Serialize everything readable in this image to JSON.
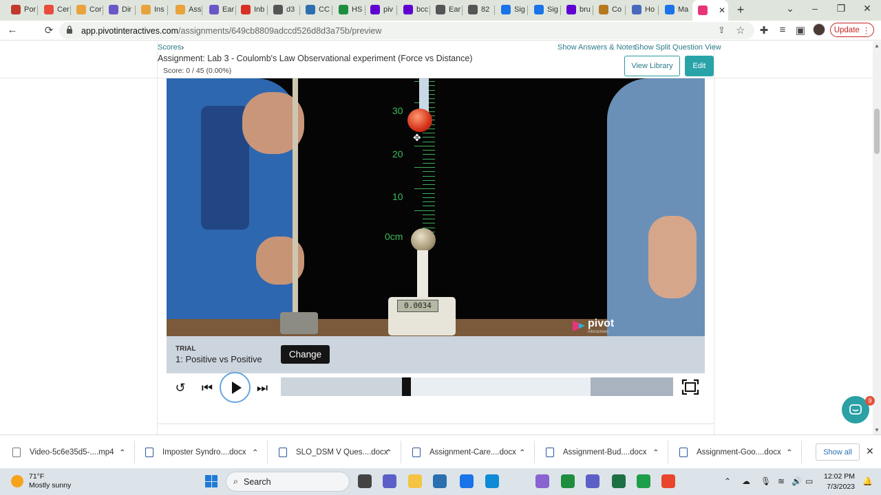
{
  "browser": {
    "tabs": [
      {
        "label": "Por",
        "color": "#c0392b"
      },
      {
        "label": "Cer",
        "color": "#e84c3d"
      },
      {
        "label": "Cor",
        "color": "#e8a33d"
      },
      {
        "label": "Dir",
        "color": "#6a55c9"
      },
      {
        "label": "Ins",
        "color": "#e8a33d"
      },
      {
        "label": "Ass",
        "color": "#e8a33d"
      },
      {
        "label": "Ear",
        "color": "#6a55c9"
      },
      {
        "label": "Inb",
        "color": "#d93025"
      },
      {
        "label": "d3",
        "color": "#555555"
      },
      {
        "label": "CC",
        "color": "#2b6fb0"
      },
      {
        "label": "HS",
        "color": "#1e8e3e"
      },
      {
        "label": "piv",
        "color": "#6001d2"
      },
      {
        "label": "bcc",
        "color": "#6001d2"
      },
      {
        "label": "Ear",
        "color": "#555555"
      },
      {
        "label": "82",
        "color": "#555555"
      },
      {
        "label": "Sig",
        "color": "#1a73e8"
      },
      {
        "label": "Sig",
        "color": "#1a73e8"
      },
      {
        "label": "bru",
        "color": "#6001d2"
      },
      {
        "label": "Co",
        "color": "#b7791f"
      },
      {
        "label": "Ho",
        "color": "#4a69bd"
      },
      {
        "label": "Ma",
        "color": "#1a73e8"
      },
      {
        "label": "",
        "color": "#e8357a"
      }
    ],
    "url_domain": "app.pivotinteractives.com",
    "url_path": "/assignments/649cb8809adccd526d8d3a75b/preview",
    "update_label": "Update"
  },
  "page": {
    "breadcrumb_scores": "Scores",
    "assignment_title": "Assignment: Lab 3 - Coulomb's Law Observational experiment (Force vs Distance)",
    "score": "Score: 0 / 45 (0.00%)",
    "show_answers": "Show Answers & Notes",
    "show_split": "Show Split Question View",
    "view_library": "View Library",
    "edit": "Edit"
  },
  "video": {
    "ruler_labels": [
      "30",
      "20",
      "10",
      "0cm"
    ],
    "scale_reading": "0.0034",
    "logo_word": "pivot",
    "logo_sub": "interactives",
    "trial_label": "TRIAL",
    "trial_value": "1: Positive vs Positive",
    "change_label": "Change",
    "playback_position": 0.32,
    "buffered_end_start": 0.79
  },
  "chat": {
    "badge": "9"
  },
  "downloads": {
    "items": [
      {
        "name": "Video-5c6e35d5-....mp4",
        "type": "video"
      },
      {
        "name": "Imposter Syndro....docx",
        "type": "doc"
      },
      {
        "name": "SLO_DSM V Ques....docx",
        "type": "doc"
      },
      {
        "name": "Assignment-Care....docx",
        "type": "doc"
      },
      {
        "name": "Assignment-Bud....docx",
        "type": "doc"
      },
      {
        "name": "Assignment-Goo....docx",
        "type": "doc"
      }
    ],
    "show_all": "Show all"
  },
  "taskbar": {
    "temperature": "71°F",
    "weather": "Mostly sunny",
    "search_label": "Search",
    "time": "12:02 PM",
    "date": "7/3/2023",
    "apps": [
      {
        "name": "task-view-app",
        "color": "#444444"
      },
      {
        "name": "teams-chat-app",
        "color": "#5b5fc7"
      },
      {
        "name": "file-explorer-app",
        "color": "#f4c542"
      },
      {
        "name": "microsoft-store-app",
        "color": "#2b6fb0"
      },
      {
        "name": "mail-app",
        "color": "#1a73e8"
      },
      {
        "name": "edge-app",
        "color": "#0f8ad7"
      },
      {
        "name": "copilot-app",
        "color": "#8a63d2"
      },
      {
        "name": "chrome-app",
        "color": "#1e8e3e"
      },
      {
        "name": "teams-app",
        "color": "#5b5fc7"
      },
      {
        "name": "excel-app",
        "color": "#1d7044"
      },
      {
        "name": "camtasia-app",
        "color": "#1d9e4a"
      },
      {
        "name": "snagit-app",
        "color": "#e8452c"
      }
    ]
  }
}
